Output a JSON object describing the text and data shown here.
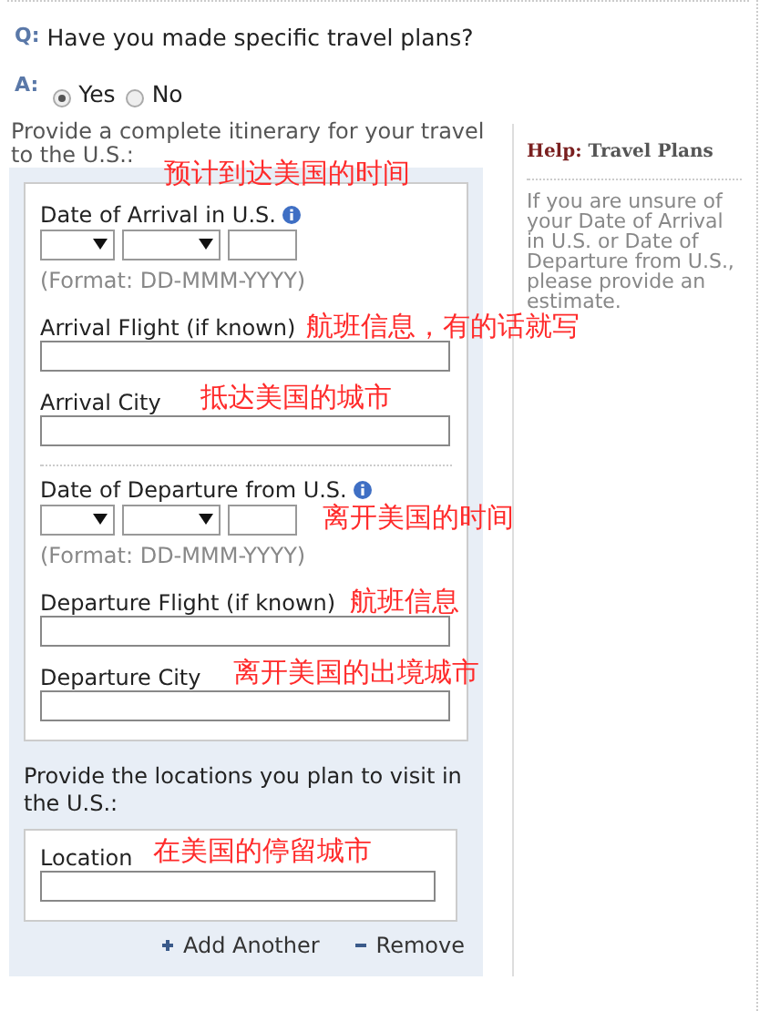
{
  "question": {
    "prefix": "Q:",
    "text": "Have you made specific travel plans?"
  },
  "answer": {
    "prefix": "A:",
    "options": [
      {
        "label": "Yes",
        "selected": true
      },
      {
        "label": "No",
        "selected": false
      }
    ]
  },
  "itinerary": {
    "title": "Provide a complete itinerary for your travel to the U.S.:",
    "fields": [
      {
        "kind": "date",
        "label": "Date of Arrival in U.S.",
        "format": "(Format: DD-MMM-YYYY)",
        "annotation": "预计到达美国的时间"
      },
      {
        "kind": "text",
        "label": "Arrival Flight (if known)",
        "annotation": "航班信息，有的话就写"
      },
      {
        "kind": "text",
        "label": "Arrival City",
        "annotation": "抵达美国的城市"
      },
      {
        "kind": "date",
        "label": "Date of Departure from U.S.",
        "format": "(Format: DD-MMM-YYYY)",
        "annotation": "离开美国的时间"
      },
      {
        "kind": "text",
        "label": "Departure Flight (if known)",
        "annotation": "航班信息"
      },
      {
        "kind": "text",
        "label": "Departure City",
        "annotation": "离开美国的出境城市"
      }
    ]
  },
  "locations": {
    "title": "Provide the locations you plan to visit in the U.S.:",
    "fields": [
      {
        "kind": "text",
        "label": "Location",
        "annotation": "在美国的停留城市"
      }
    ],
    "actions": [
      {
        "kind": "add",
        "label": "Add Another"
      },
      {
        "kind": "remove",
        "label": "Remove"
      }
    ]
  },
  "help": {
    "prefix": "Help:",
    "title": "Travel Plans",
    "text": "If you are unsure of your Date of Arrival in U.S. or Date of Departure from U.S., please provide an estimate."
  }
}
